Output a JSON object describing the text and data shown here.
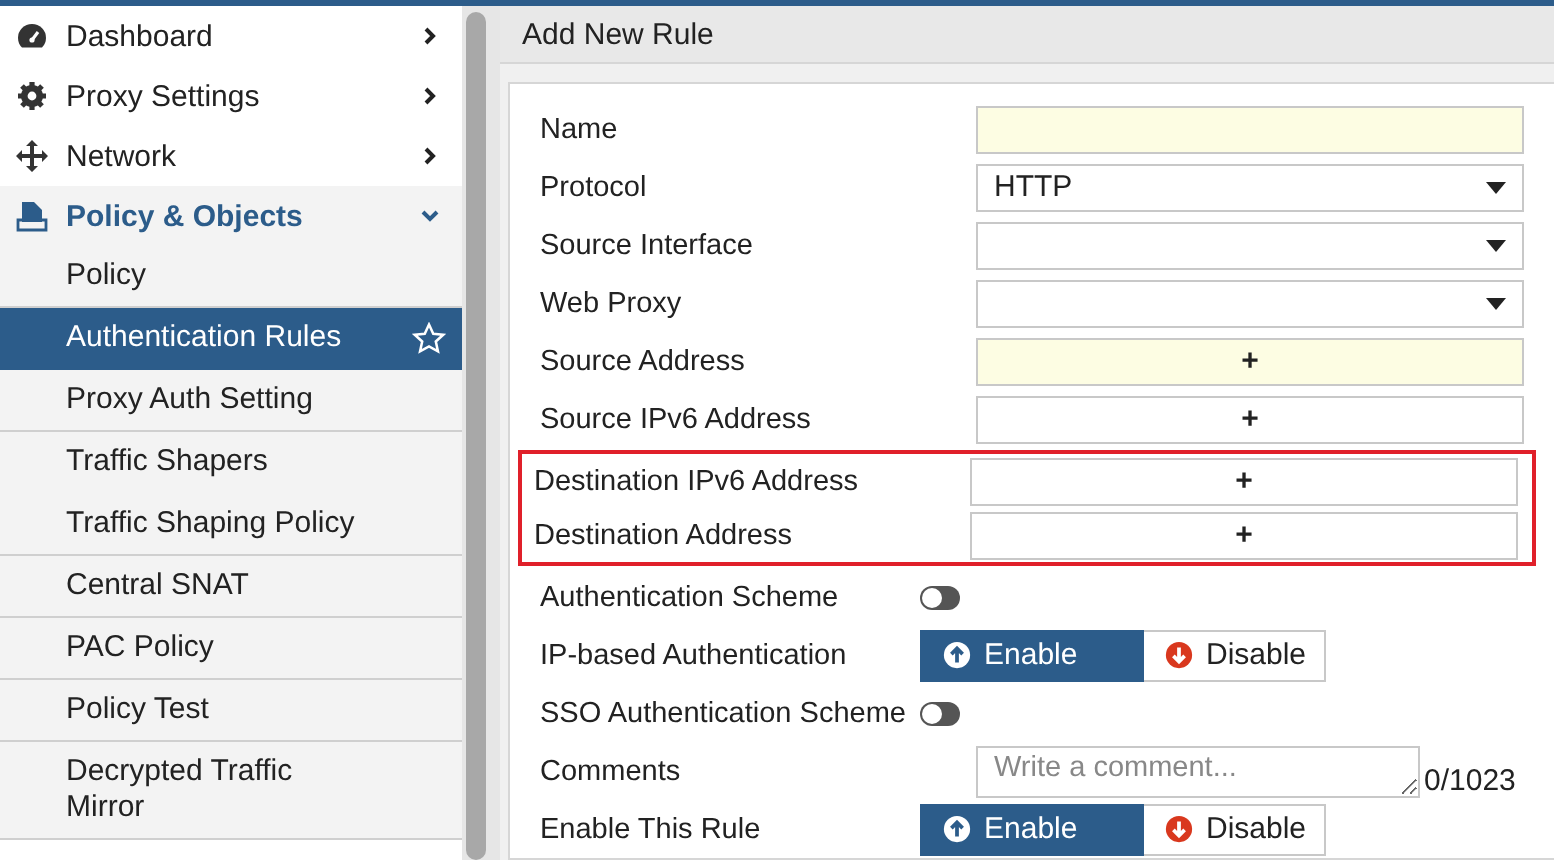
{
  "sidebar": {
    "items": [
      {
        "label": "Dashboard",
        "expanded": false
      },
      {
        "label": "Proxy Settings",
        "expanded": false
      },
      {
        "label": "Network",
        "expanded": false
      },
      {
        "label": "Policy & Objects",
        "expanded": true,
        "children": [
          {
            "label": "Policy",
            "selected": false,
            "group_end": true
          },
          {
            "label": "Authentication Rules",
            "selected": true,
            "group_end": false
          },
          {
            "label": "Proxy Auth Setting",
            "selected": false,
            "group_end": true
          },
          {
            "label": "Traffic Shapers",
            "selected": false,
            "group_end": false
          },
          {
            "label": "Traffic Shaping Policy",
            "selected": false,
            "group_end": true
          },
          {
            "label": "Central SNAT",
            "selected": false,
            "group_end": true
          },
          {
            "label": "PAC Policy",
            "selected": false,
            "group_end": true
          },
          {
            "label": "Policy Test",
            "selected": false,
            "group_end": true
          },
          {
            "label": "Decrypted Traffic Mirror",
            "selected": false,
            "group_end": true
          }
        ]
      }
    ]
  },
  "panel": {
    "title": "Add New Rule"
  },
  "form": {
    "rows": [
      {
        "label": "Name",
        "kind": "text",
        "highlighted": true,
        "boxed": false
      },
      {
        "label": "Protocol",
        "kind": "select",
        "value": "HTTP",
        "boxed": false
      },
      {
        "label": "Source Interface",
        "kind": "select",
        "boxed": false
      },
      {
        "label": "Web Proxy",
        "kind": "select",
        "boxed": false
      },
      {
        "label": "Source Address",
        "kind": "picker",
        "add": "+",
        "highlighted": true,
        "boxed": false
      },
      {
        "label": "Source IPv6 Address",
        "kind": "picker",
        "add": "+",
        "highlighted": false,
        "boxed": false
      },
      {
        "label": "Destination IPv6 Address",
        "kind": "picker",
        "add": "+",
        "highlighted": false,
        "boxed": true
      },
      {
        "label": "Destination Address",
        "kind": "picker",
        "add": "+",
        "highlighted": false,
        "boxed": true
      },
      {
        "label": "Authentication Scheme",
        "kind": "toggle",
        "on": false,
        "boxed": false
      },
      {
        "label": "IP-based Authentication",
        "kind": "radio",
        "boxed": false,
        "options": [
          {
            "label": "Enable",
            "selected": true
          },
          {
            "label": "Disable",
            "selected": false
          }
        ]
      },
      {
        "label": "SSO Authentication Scheme",
        "kind": "toggle",
        "on": false,
        "boxed": false
      },
      {
        "label": "Comments",
        "kind": "textarea",
        "placeholder": "Write a comment...",
        "counter": "0/1023",
        "boxed": false
      },
      {
        "label": "Enable This Rule",
        "kind": "radio",
        "boxed": false,
        "options": [
          {
            "label": "Enable",
            "selected": true
          },
          {
            "label": "Disable",
            "selected": false
          }
        ]
      }
    ]
  }
}
